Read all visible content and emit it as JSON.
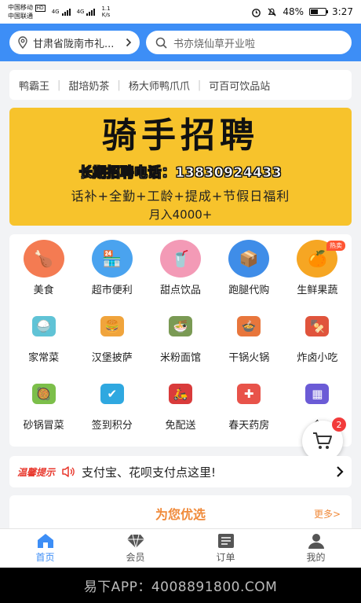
{
  "status": {
    "carrier1": "中国移动",
    "carrier1_tag": "HD",
    "carrier2": "中国联通",
    "net1": "4G",
    "net2": "4G",
    "speed_value": "1.1",
    "speed_unit": "K/s",
    "battery_percent": "48%",
    "battery_level": 0.48,
    "time": "3:27",
    "icons": [
      "alarm-icon",
      "mute-icon",
      "battery-icon"
    ]
  },
  "header": {
    "location": "甘肃省陇南市礼...",
    "search_placeholder": "书亦烧仙草开业啦",
    "color": "#3d8ef6"
  },
  "shop_tags": [
    "鸭霸王",
    "甜培奶茶",
    "杨大师鸭爪爪",
    "可百可饮品站"
  ],
  "banner": {
    "title": "骑手招聘",
    "phone_line": "长期招聘电话：13830924433",
    "benefits": "话补+全勤+工龄+提成+节假日福利",
    "salary": "月入4000+",
    "color": "#f7c32c"
  },
  "categories": [
    {
      "label": "美食",
      "icon": "roast-chicken-icon",
      "color": "#f47b52"
    },
    {
      "label": "超市便利",
      "icon": "store-icon",
      "color": "#4aa3ef"
    },
    {
      "label": "甜点饮品",
      "icon": "bubble-tea-icon",
      "color": "#f39ab6"
    },
    {
      "label": "跑腿代购",
      "icon": "delivery-box-icon",
      "color": "#3f8de8"
    },
    {
      "label": "生鲜果蔬",
      "icon": "orange-icon",
      "color": "#f6a623",
      "badge": "热卖"
    },
    {
      "label": "家常菜",
      "icon": "rice-bowl-icon",
      "color": "#60c3d6"
    },
    {
      "label": "汉堡披萨",
      "icon": "burger-icon",
      "color": "#f0a43c"
    },
    {
      "label": "米粉面馆",
      "icon": "noodle-bowl-icon",
      "color": "#7a9a54"
    },
    {
      "label": "干锅火锅",
      "icon": "hotpot-icon",
      "color": "#e8763c"
    },
    {
      "label": "炸卤小吃",
      "icon": "snack-cart-icon",
      "color": "#e0543c"
    },
    {
      "label": "砂锅冒菜",
      "icon": "clay-pot-icon",
      "color": "#7cbf4a"
    },
    {
      "label": "签到积分",
      "icon": "calendar-check-icon",
      "color": "#2fa8e0"
    },
    {
      "label": "免配送",
      "icon": "scooter-icon",
      "color": "#d93b3b"
    },
    {
      "label": "春天药房",
      "icon": "pharmacy-icon",
      "color": "#e8534a"
    },
    {
      "label": "全",
      "icon": "grid-icon",
      "color": "#6b5bd6"
    }
  ],
  "cart": {
    "count": "2"
  },
  "notice": {
    "tag": "温馨提示",
    "text": "支付宝、花呗支付点这里!"
  },
  "recommend": {
    "title": "为您优选",
    "more": "更多>"
  },
  "tabs": [
    {
      "label": "首页",
      "icon": "home-icon",
      "active": true
    },
    {
      "label": "会员",
      "icon": "diamond-icon"
    },
    {
      "label": "订单",
      "icon": "order-list-icon"
    },
    {
      "label": "我的",
      "icon": "user-icon"
    }
  ],
  "watermark": "易下APP：4008891800.COM"
}
